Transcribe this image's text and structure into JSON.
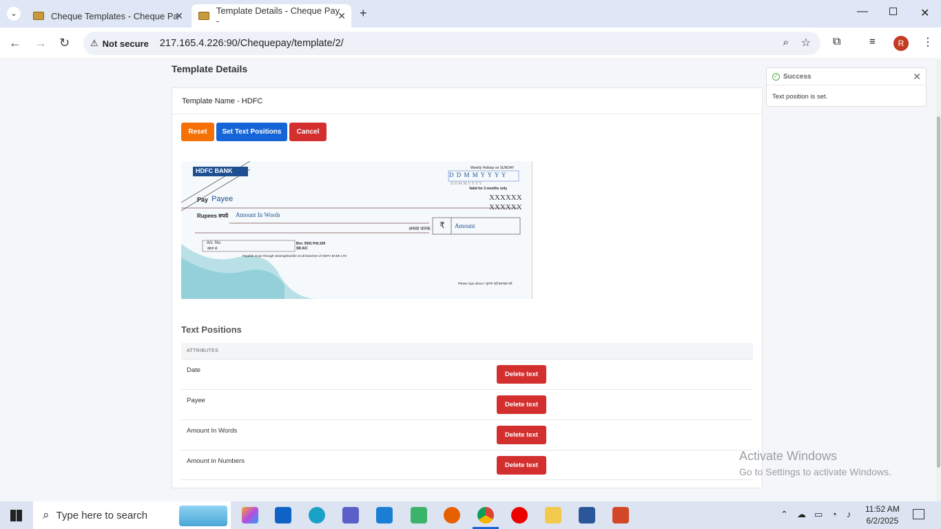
{
  "browser": {
    "tabs": [
      {
        "title": "Cheque Templates - Cheque Pa"
      },
      {
        "title": "Template Details - Cheque Pay -"
      }
    ],
    "security": "Not secure",
    "url": "217.165.4.226:90/Chequepay/template/2/",
    "profile_initial": "R"
  },
  "page": {
    "title": "Template Details",
    "template_name": "Template Name - HDFC",
    "buttons": {
      "reset": "Reset",
      "set_positions": "Set Text Positions",
      "cancel": "Cancel"
    },
    "cheque": {
      "bank": "HDFC BANK",
      "weekly_holiday": "Weekly Holiday on SUNDAY",
      "date_boxes": "D D M M Y Y Y Y",
      "date_hint": "D  D  M  M  Y  Y  Y  Y",
      "valid": "Valid for 3 months only",
      "pay": "Pay",
      "payee": "Payee",
      "rupees": "Rupees रुपये",
      "amount_words": "Amount In Words",
      "or_bearer": "अथवा धारक",
      "rupee_symbol": "₹",
      "amount": "Amount",
      "ac_no": "A/c. No.",
      "ac_no_hi": "खाता सं.",
      "branch": "Brn: 0501  Pdt:100",
      "sb_ac": "SB A/C",
      "payable": "Payable at par through clearing/transfer at all branches of HDFC BANK LTD",
      "sign": "Please sign above / कृपया यहाँ हस्ताक्षर करें",
      "xxx": "XXXXXX"
    },
    "text_positions": {
      "heading": "Text Positions",
      "column": "ATTRIBUTES",
      "delete_label": "Delete text",
      "rows": [
        "Date",
        "Payee",
        "Amount In Words",
        "Amount in Numbers"
      ]
    },
    "toast": {
      "title": "Success",
      "message": "Text position is set."
    },
    "watermark": {
      "line1": "Activate Windows",
      "line2": "Go to Settings to activate Windows."
    }
  },
  "taskbar": {
    "search_placeholder": "Type here to search",
    "time": "11:52 AM",
    "date": "6/2/2025"
  },
  "colors": {
    "reset": "#f57005",
    "set": "#1565d8",
    "cancel": "#d32f2f",
    "delete": "#d32f2f"
  }
}
